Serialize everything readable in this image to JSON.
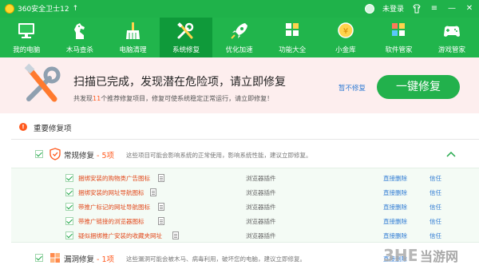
{
  "window": {
    "title": "360安全卫士12",
    "user": "未登录"
  },
  "toolbar": [
    {
      "id": "my-pc",
      "label": "我的电脑",
      "icon": "monitor-icon",
      "active": false
    },
    {
      "id": "trojan",
      "label": "木马查杀",
      "icon": "horse-icon",
      "active": false
    },
    {
      "id": "cleanup",
      "label": "电脑清理",
      "icon": "broom-icon",
      "active": false
    },
    {
      "id": "repair",
      "label": "系统修复",
      "icon": "wrench-screwdriver-icon",
      "active": true
    },
    {
      "id": "speedup",
      "label": "优化加速",
      "icon": "rocket-icon",
      "active": false
    },
    {
      "id": "features",
      "label": "功能大全",
      "icon": "grid-icon",
      "active": false
    },
    {
      "id": "coin",
      "label": "小金库",
      "icon": "coin-icon",
      "active": false
    },
    {
      "id": "software",
      "label": "软件管家",
      "icon": "software-cube-icon",
      "active": false
    },
    {
      "id": "games",
      "label": "游戏管家",
      "icon": "gamepad-icon",
      "active": false
    }
  ],
  "banner": {
    "headline": "扫描已完成，发现潜在危险项，请立即修复",
    "sub_prefix": "共发现",
    "sub_count": "11",
    "sub_suffix": "个推荐修复项目，修复可使系统稳定正常运行，请立即修复！",
    "pause_label": "暂不修复",
    "fix_label": "一键修复"
  },
  "section": {
    "title": "重要修复项"
  },
  "categories": [
    {
      "name": "常规修复",
      "sep": " - ",
      "count": "5项",
      "desc": "这些项目可能会影响系统的正常使用，影响系统性能，建议立即修复。"
    },
    {
      "name": "漏洞修复",
      "sep": " - ",
      "count": "1项",
      "desc": "这些漏洞可能会被木马、病毒利用，破坏您的电脑，建议立即修复。"
    }
  ],
  "items": [
    {
      "name": "捆绑安装的购物类广告图标",
      "type": "浏览器插件",
      "delete": "直接删除",
      "trust": "信任"
    },
    {
      "name": "捆绑安装的网址导航图标",
      "type": "浏览器插件",
      "delete": "直接删除",
      "trust": "信任"
    },
    {
      "name": "带推广标记的网址导航图标",
      "type": "浏览器插件",
      "delete": "直接删除",
      "trust": "信任"
    },
    {
      "name": "带推广链接的浏览器图标",
      "type": "浏览器插件",
      "delete": "直接删除",
      "trust": "信任"
    },
    {
      "name": "疑似捆绑推广安装的收藏夹网址",
      "type": "浏览器插件",
      "delete": "直接删除",
      "trust": "信任"
    }
  ],
  "partial_action": "直接删除",
  "watermark": {
    "text": "当游网",
    "logo": "3HE"
  },
  "colors": {
    "brand_green": "#21b54c",
    "active_tab": "#0f9a3a",
    "banner_bg": "#fdeeee",
    "warn_orange": "#ff5a1f",
    "link_blue": "#2f7bd4"
  }
}
